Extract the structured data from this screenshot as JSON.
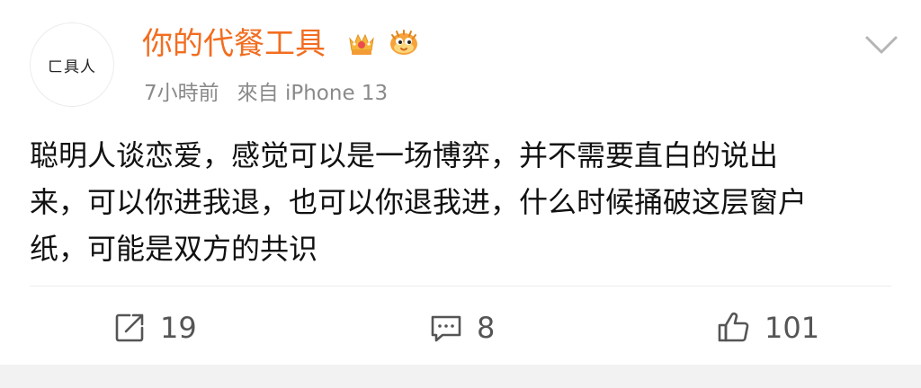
{
  "user": {
    "avatar_text": "ㄈ具人",
    "name": "你的代餐工具",
    "badges": [
      "crown-badge-icon",
      "pufferfish-badge-icon"
    ]
  },
  "meta": {
    "time": "7小時前",
    "source": "來自 iPhone 13"
  },
  "post": {
    "content": "聪明人谈恋爱，感觉可以是一场博弈，并不需要直白的说出\n来，可以你进我退，也可以你退我进，什么时候捅破这层窗户\n纸，可能是双方的共识"
  },
  "actions": {
    "repost_count": "19",
    "comment_count": "8",
    "like_count": "101"
  },
  "colors": {
    "username": "#f26d20",
    "meta": "#8a8a8a",
    "text": "#111111",
    "icon": "#555555"
  }
}
